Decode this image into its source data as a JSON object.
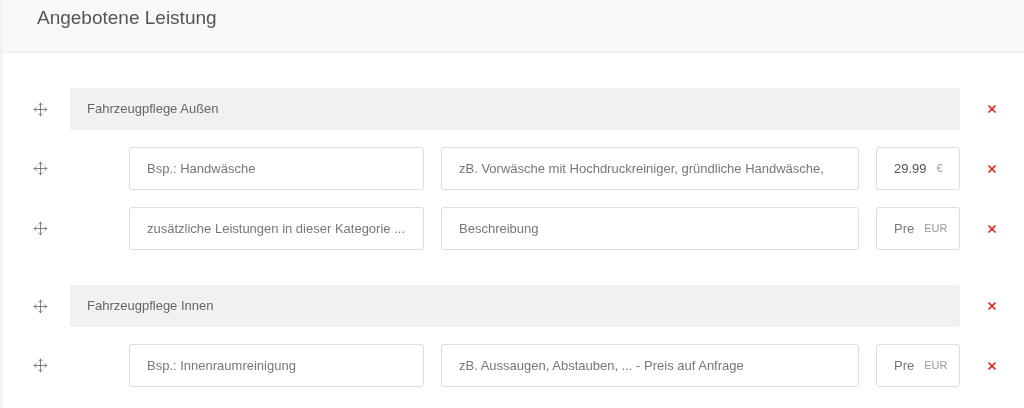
{
  "title": "Angebotene Leistung",
  "categories": [
    {
      "name": "Fahrzeugpflege Außen",
      "items": [
        {
          "name": {
            "placeholder": "Bsp.: Handwäsche"
          },
          "description": {
            "placeholder": "zB. Vorwäsche mit Hochdruckreiniger, gründliche Handwäsche,"
          },
          "price": {
            "value": "29.99"
          },
          "currency": "€"
        },
        {
          "name": {
            "placeholder": "zusätzliche Leistungen in dieser Kategorie ..."
          },
          "description": {
            "placeholder": "Beschreibung"
          },
          "price": {
            "placeholder": "Pre"
          },
          "currency": "EUR"
        }
      ]
    },
    {
      "name": "Fahrzeugpflege Innen",
      "items": [
        {
          "name": {
            "placeholder": "Bsp.: Innenraumreinigung"
          },
          "description": {
            "placeholder": "zB. Aussaugen, Abstauben, ... - Preis auf Anfrage"
          },
          "price": {
            "placeholder": "Pre"
          },
          "currency": "EUR"
        }
      ]
    }
  ]
}
